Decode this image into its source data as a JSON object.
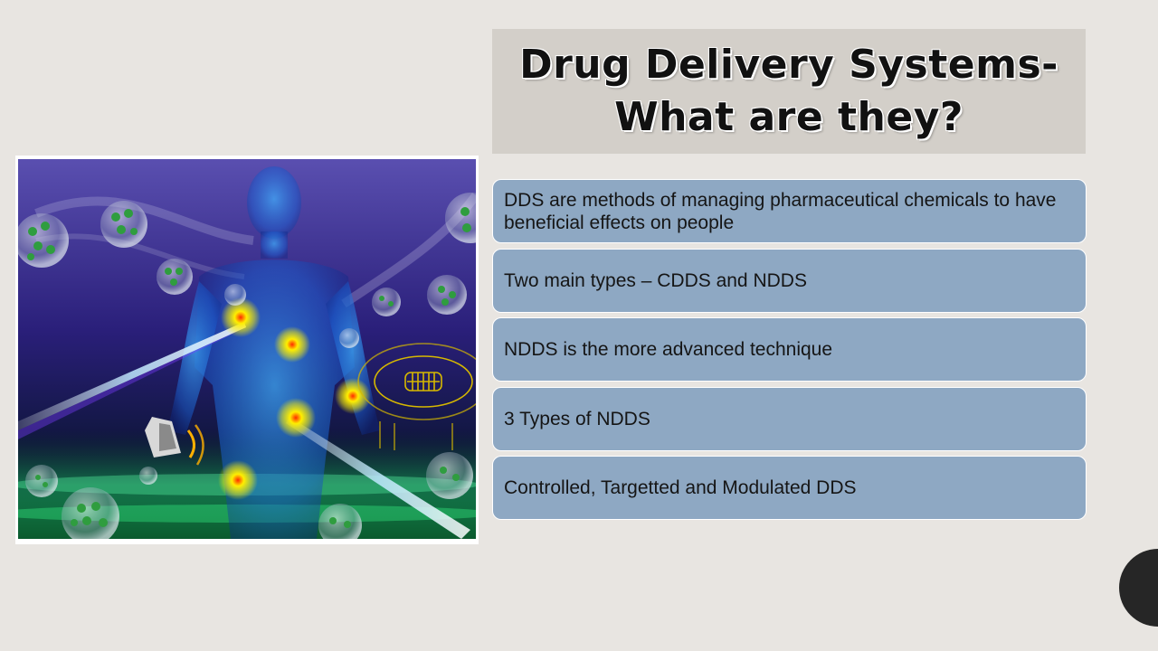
{
  "slide": {
    "title_line1": "Drug Delivery Systems-",
    "title_line2": "What are they?",
    "bullets": [
      "DDS are methods of managing pharmaceutical chemicals to have beneficial effects on people",
      "Two main types – CDDS and NDDS",
      "NDDS is the more advanced technique",
      "3 Types of NDDS",
      "Controlled, Targetted and Modulated DDS"
    ]
  },
  "colors": {
    "background": "#e8e5e1",
    "title_box": "#d3cfc9",
    "bullet_box": "#8ea8c3",
    "corner_circle": "#262626"
  }
}
